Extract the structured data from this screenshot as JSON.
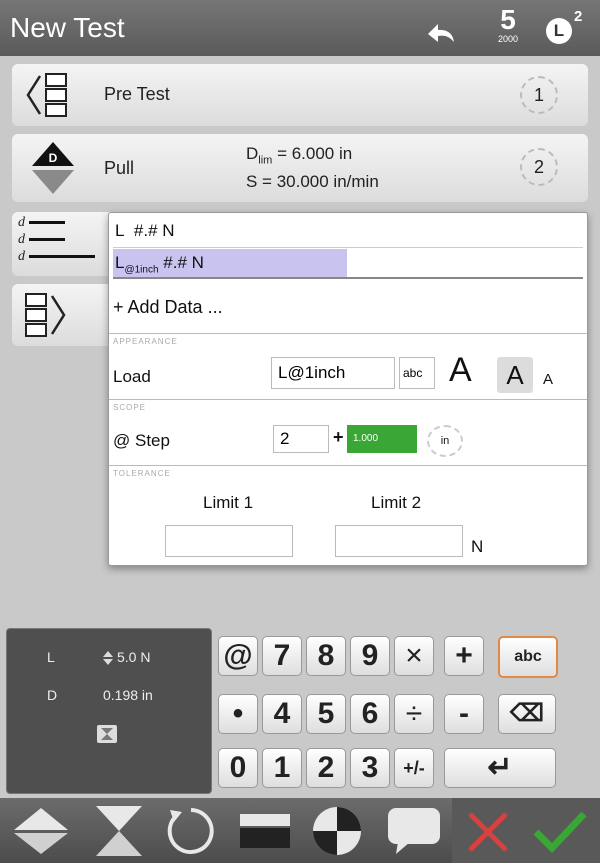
{
  "header": {
    "title": "New Test",
    "counter": "5",
    "counter_sub": "2000",
    "load_cell": "L",
    "load_cell_sup": "2"
  },
  "steps": [
    {
      "label": "Pre Test",
      "number": "1"
    },
    {
      "label": "Pull",
      "number": "2",
      "line1_main": "D",
      "line1_sub": "lim",
      "line1_rest": " = 6.000 in",
      "line2": "S = 30.000 in/min"
    }
  ],
  "data_icon": {
    "letters": [
      "d",
      "d",
      "d"
    ]
  },
  "popup": {
    "items": [
      {
        "prefix": "L",
        "text": "#.# N"
      },
      {
        "prefix": "L",
        "sub": "@1inch",
        "text": "#.# N"
      }
    ],
    "add_data": "+ Add Data ...",
    "appearance": {
      "section": "APPEARANCE",
      "label": "Load",
      "value": "L@1inch",
      "abc": "abc",
      "size_large": "A",
      "size_medium": "A",
      "size_small": "A"
    },
    "scope": {
      "section": "SCOPE",
      "label": "@ Step",
      "step_value": "2",
      "plus": "+",
      "offset": "1.000",
      "unit": "in"
    },
    "tolerance": {
      "section": "TOLERANCE",
      "limit1": "Limit 1",
      "limit2": "Limit 2",
      "unit": "N"
    }
  },
  "readout": {
    "l_label": "L",
    "l_value": "5.0 N",
    "d_label": "D",
    "d_value": "0.198 in"
  },
  "keypad": {
    "row1": [
      "@",
      "7",
      "8",
      "9",
      "×",
      "+",
      "abc"
    ],
    "row2": [
      "•",
      "4",
      "5",
      "6",
      "÷",
      "-",
      "⌫"
    ],
    "row3": [
      "0",
      "1",
      "2",
      "3",
      "+/-",
      "↵"
    ]
  },
  "colors": {
    "accent_green": "#3aa635",
    "highlight_purple": "#c9c3ef",
    "cancel_red": "#d94040"
  }
}
